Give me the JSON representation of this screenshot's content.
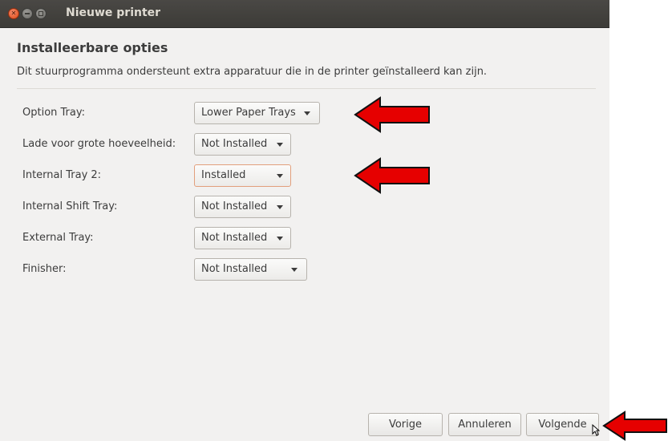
{
  "window": {
    "title": "Nieuwe printer",
    "controls": [
      "close-icon",
      "minimize-icon",
      "maximize-icon"
    ]
  },
  "page": {
    "heading": "Installeerbare opties",
    "description": "Dit stuurprogramma ondersteunt extra apparatuur die in de printer geïnstalleerd kan zijn."
  },
  "options": [
    {
      "label": "Option Tray:",
      "value": "Lower Paper Trays"
    },
    {
      "label": "Lade voor grote hoeveelheid:",
      "value": "Not Installed"
    },
    {
      "label": "Internal Tray 2:",
      "value": "Installed"
    },
    {
      "label": "Internal Shift Tray:",
      "value": "Not Installed"
    },
    {
      "label": "External Tray:",
      "value": "Not Installed"
    },
    {
      "label": "Finisher:",
      "value": "Not Installed"
    }
  ],
  "buttons": {
    "back": "Vorige",
    "cancel": "Annuleren",
    "next": "Volgende"
  },
  "annotation_color": "#e60000",
  "colors": {
    "titlebar": "#3c3b37",
    "window_bg": "#f2f1f0",
    "close_button": "#df4a16"
  }
}
